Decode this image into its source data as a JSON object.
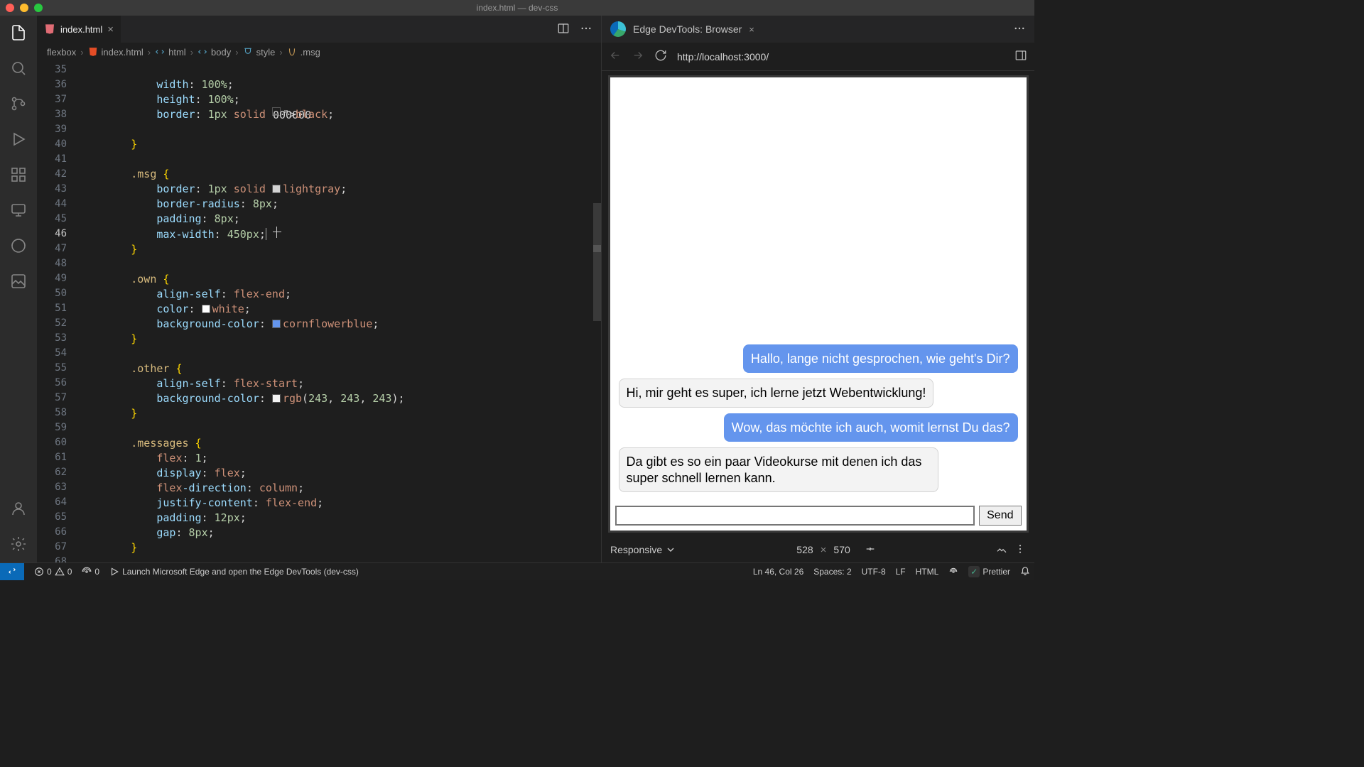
{
  "window": {
    "title": "index.html — dev-css"
  },
  "tab": {
    "filename": "index.html"
  },
  "devtools_tab": {
    "title": "Edge DevTools: Browser"
  },
  "breadcrumbs": [
    {
      "label": "flexbox"
    },
    {
      "label": "index.html",
      "icon": "html"
    },
    {
      "label": "html",
      "icon": "tag"
    },
    {
      "label": "body",
      "icon": "tag"
    },
    {
      "label": "style",
      "icon": "style"
    },
    {
      "label": ".msg",
      "icon": "selector"
    }
  ],
  "gutter": {
    "start": 35,
    "end": 68,
    "active": 46
  },
  "code": [
    "",
    "            width: 100%;",
    "            height: 100%;",
    "            border: 1px solid ◧black;",
    "",
    "        }",
    "",
    "        .msg {",
    "            border: 1px solid ◧lightgray;",
    "            border-radius: 8px;",
    "            padding: 8px;",
    "            max-width: 450px;| ✚",
    "        }",
    "",
    "        .own {",
    "            align-self: flex-end;",
    "            color: ◧white;",
    "            background-color: ◧cornflowerblue;",
    "        }",
    "",
    "        .other {",
    "            align-self: flex-start;",
    "            background-color: ◧rgb(243, 243, 243);",
    "        }",
    "",
    "        .messages {",
    "            flex: 1;",
    "            display: flex;",
    "            flex-direction: column;",
    "            justify-content: flex-end;",
    "            padding: 12px;",
    "            gap: 8px;",
    "        }",
    ""
  ],
  "swatches": {
    "black": "#000000",
    "lightgray": "#d3d3d3",
    "white": "#ffffff",
    "cornflowerblue": "#6495ed",
    "rgb243": "#f3f3f3"
  },
  "browser": {
    "url": "http://localhost:3000/"
  },
  "preview": {
    "messages": [
      {
        "cls": "own",
        "text": "Hallo, lange nicht gesprochen, wie geht's Dir?"
      },
      {
        "cls": "other",
        "text": "Hi, mir geht es super, ich lerne jetzt Webentwicklung!"
      },
      {
        "cls": "own",
        "text": "Wow, das möchte ich auch, womit lernst Du das?"
      },
      {
        "cls": "other",
        "text": "Da gibt es so ein paar Videokurse mit denen ich das super schnell lernen kann."
      }
    ],
    "send_label": "Send"
  },
  "preview_status": {
    "device": "Responsive",
    "width": "528",
    "height": "570"
  },
  "statusbar": {
    "errors": "0",
    "warnings": "0",
    "port": "0",
    "launch_msg": "Launch Microsoft Edge and open the Edge DevTools (dev-css)",
    "cursor": "Ln 46, Col 26",
    "spaces": "Spaces: 2",
    "encoding": "UTF-8",
    "eol": "LF",
    "lang": "HTML",
    "prettier": "Prettier"
  }
}
